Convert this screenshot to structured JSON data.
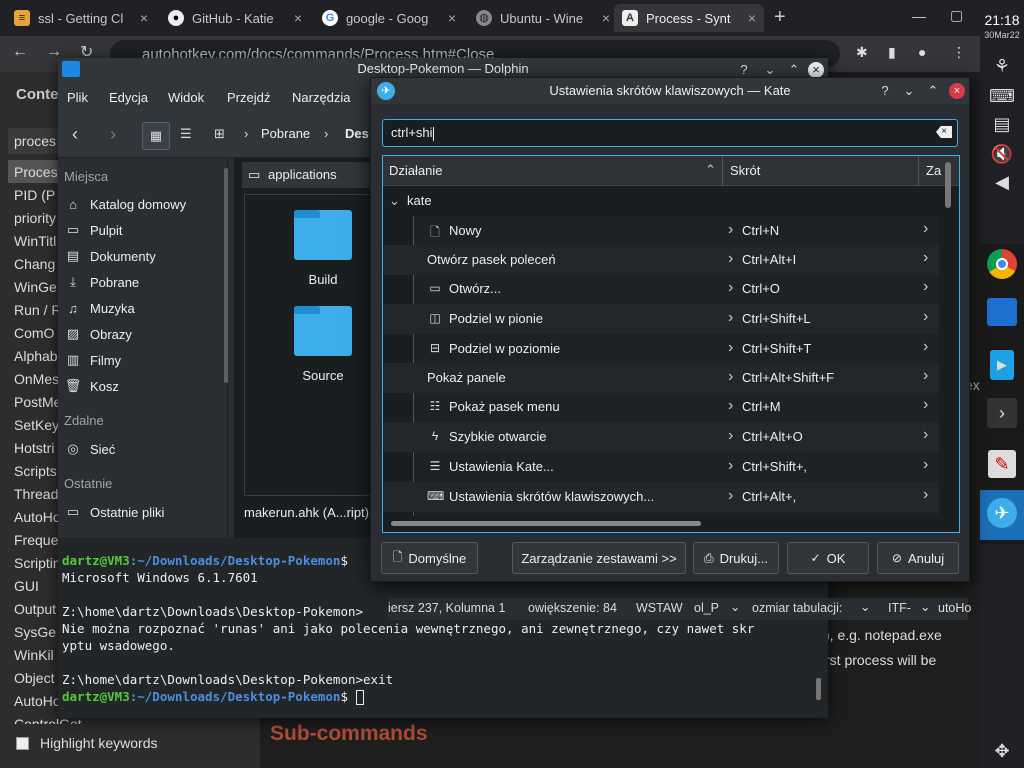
{
  "chrome": {
    "tabs": [
      {
        "title": "ssl - Getting Cl",
        "favicon": "yellow-icon"
      },
      {
        "title": "GitHub - Katie",
        "favicon": "github-icon"
      },
      {
        "title": "google - Goog",
        "favicon": "google-icon"
      },
      {
        "title": "Ubuntu - Wine",
        "favicon": "globe-icon"
      },
      {
        "title": "Process - Synt",
        "favicon": "autohotkey-icon"
      }
    ],
    "address": "autohotkey.com/docs/commands/Process.htm#Close"
  },
  "webpage": {
    "sidebar_header": "Conte",
    "search_value": "proces",
    "list": [
      "Proces",
      "PID (P",
      "priority",
      "WinTitl",
      "Chang",
      "WinGe",
      "Run / R",
      "ComO",
      "Alphab",
      "OnMes",
      "PostMe",
      "SetKey",
      "Hotstri",
      "Scripts",
      "Thread",
      "AutoHo",
      "Freque",
      "Scriptin",
      "GUI",
      "Output",
      "SysGe",
      "WinKil",
      "Object",
      "AutoHo",
      "ControlGet"
    ],
    "highlight_keywords": "Highlight keywords",
    "subheading": "Sub-commands",
    "snippet1": "), e.g. notepad.exe",
    "snippet2": "rst process will be",
    "snippet3": "ex"
  },
  "shelf": {
    "time": "21:18",
    "date": "30Mar22"
  },
  "dolphin": {
    "title": "Desktop-Pokemon — Dolphin",
    "menu": [
      "Plik",
      "Edycja",
      "Widok",
      "Przejdź",
      "Narzędzia"
    ],
    "breadcrumb": [
      "Pobrane",
      "Des"
    ],
    "places": {
      "heading": "Miejsca",
      "items": [
        "Katalog domowy",
        "Pulpit",
        "Dokumenty",
        "Pobrane",
        "Muzyka",
        "Obrazy",
        "Filmy",
        "Kosz"
      ],
      "remote_heading": "Zdalne",
      "remote": [
        "Sieć"
      ],
      "recent_heading": "Ostatnie",
      "recent": [
        "Ostatnie pliki"
      ]
    },
    "tab_label": "applications",
    "files": [
      "Build",
      "Source"
    ],
    "bottom_file": "makerun.ahk (A...ript)",
    "status_partial": [
      "iersz 237, Kolumna 1",
      "owiększenie: 84",
      "WSTAW",
      "ol_P",
      "ozmiar tabulacji:",
      "ITF-",
      "utoHo"
    ]
  },
  "terminal": {
    "prompt_user": "dartz@VM3",
    "prompt_path": ":~/Downloads/Desktop-Pokemon",
    "line1": "Microsoft Windows 6.1.7601",
    "line2": "Z:\\home\\dartz\\Downloads\\Desktop-Pokemon>",
    "line3": "Nie można rozpoznać 'runas' ani jako polecenia wewnętrznego, ani zewnętrznego, czy nawet skr",
    "line4": "yptu wsadowego.",
    "line5": "Z:\\home\\dartz\\Downloads\\Desktop-Pokemon>exit"
  },
  "kate": {
    "title": "Ustawienia skrótów klawiszowych — Kate",
    "search": "ctrl+shi",
    "columns": [
      "Działanie",
      "Skrót",
      "Za"
    ],
    "group": "kate",
    "rows": [
      {
        "name": "Nowy",
        "icon": "new-file-icon",
        "shortcut": "Ctrl+N"
      },
      {
        "name": "Otwórz pasek poleceń",
        "icon": "",
        "shortcut": "Ctrl+Alt+I"
      },
      {
        "name": "Otwórz...",
        "icon": "folder-icon",
        "shortcut": "Ctrl+O"
      },
      {
        "name": "Podziel w pionie",
        "icon": "split-vertical-icon",
        "shortcut": "Ctrl+Shift+L"
      },
      {
        "name": "Podziel w poziomie",
        "icon": "split-horizontal-icon",
        "shortcut": "Ctrl+Shift+T"
      },
      {
        "name": "Pokaż panele",
        "icon": "",
        "shortcut": "Ctrl+Alt+Shift+F"
      },
      {
        "name": "Pokaż pasek menu",
        "icon": "menu-bar-icon",
        "shortcut": "Ctrl+M"
      },
      {
        "name": "Szybkie otwarcie",
        "icon": "lightning-icon",
        "shortcut": "Ctrl+Alt+O"
      },
      {
        "name": "Ustawienia Kate...",
        "icon": "settings-icon",
        "shortcut": "Ctrl+Shift+,"
      },
      {
        "name": "Ustawienia skrótów klawiszowych...",
        "icon": "keyboard-icon",
        "shortcut": "Ctrl+Alt+,"
      }
    ],
    "buttons": {
      "defaults": "Domyślne",
      "schemes": "Zarządzanie zestawami >>",
      "print": "Drukuj...",
      "ok": "OK",
      "cancel": "Anuluj"
    }
  }
}
